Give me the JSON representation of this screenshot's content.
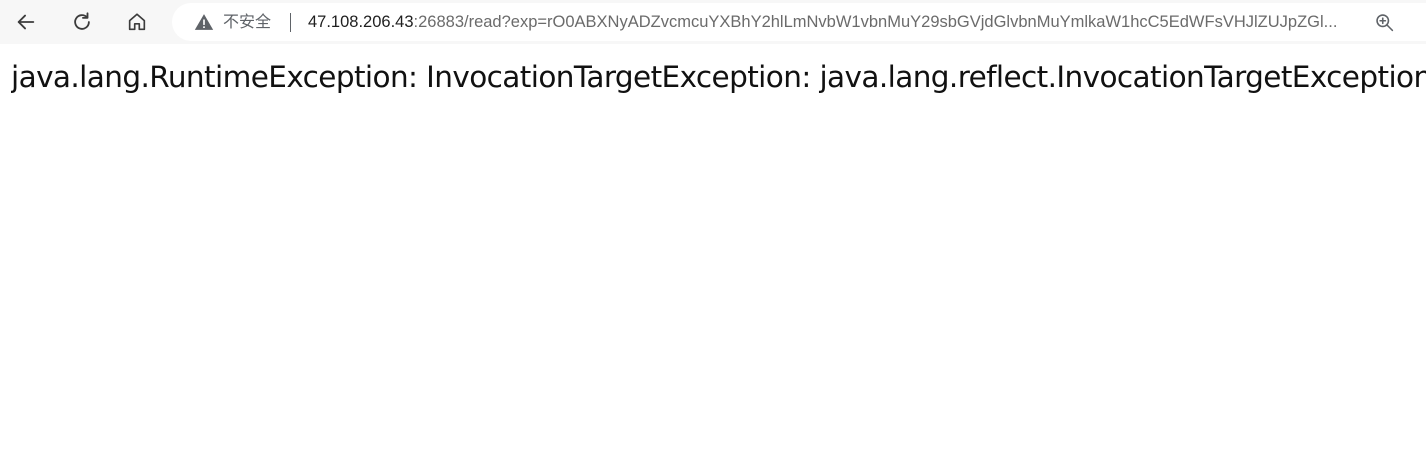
{
  "browser": {
    "nav": {
      "back_icon": "arrow-left-icon",
      "reload_icon": "reload-icon",
      "home_icon": "home-icon"
    },
    "address_bar": {
      "security_icon": "warning-triangle-icon",
      "security_label": "不安全",
      "url_host": "47.108.206.43",
      "url_rest": ":26883/read?exp=rO0ABXNyADZvcmcuYXBhY2hlLmNvbW1vbnMuY29sbGVjdGlvbnMuYmlkaW1hcC5EdWFsVHJlZUJpZGl...",
      "zoom_icon": "zoom-in-icon"
    },
    "colors": {
      "toolbar_bg": "#f7f7f7",
      "omnibox_bg": "#ffffff",
      "text_primary": "#1f1f1f",
      "text_secondary": "#5f6368"
    }
  },
  "page": {
    "error_message": "java.lang.RuntimeException: InvocationTargetException: java.lang.reflect.InvocationTargetException"
  }
}
